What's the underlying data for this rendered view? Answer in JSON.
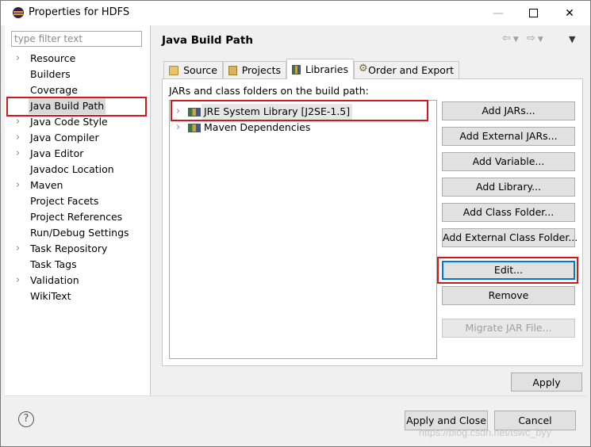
{
  "window": {
    "title": "Properties for HDFS"
  },
  "sidebar": {
    "filter_placeholder": "type filter text",
    "items": [
      {
        "label": "Resource",
        "expandable": true
      },
      {
        "label": "Builders",
        "expandable": false
      },
      {
        "label": "Coverage",
        "expandable": false
      },
      {
        "label": "Java Build Path",
        "expandable": false,
        "selected": true
      },
      {
        "label": "Java Code Style",
        "expandable": true
      },
      {
        "label": "Java Compiler",
        "expandable": true
      },
      {
        "label": "Java Editor",
        "expandable": true
      },
      {
        "label": "Javadoc Location",
        "expandable": false
      },
      {
        "label": "Maven",
        "expandable": true
      },
      {
        "label": "Project Facets",
        "expandable": false
      },
      {
        "label": "Project References",
        "expandable": false
      },
      {
        "label": "Run/Debug Settings",
        "expandable": false
      },
      {
        "label": "Task Repository",
        "expandable": true
      },
      {
        "label": "Task Tags",
        "expandable": false
      },
      {
        "label": "Validation",
        "expandable": true
      },
      {
        "label": "WikiText",
        "expandable": false
      }
    ]
  },
  "main": {
    "title": "Java Build Path",
    "tabs": [
      {
        "label": "Source",
        "icon": "folder-icon"
      },
      {
        "label": "Projects",
        "icon": "project-icon"
      },
      {
        "label": "Libraries",
        "icon": "library-icon",
        "active": true
      },
      {
        "label": "Order and Export",
        "icon": "order-icon"
      }
    ],
    "panel_label": "JARs and class folders on the build path:",
    "libraries": [
      {
        "label": "JRE System Library [J2SE-1.5]",
        "selected": true
      },
      {
        "label": "Maven Dependencies",
        "selected": false
      }
    ],
    "buttons": {
      "add_jars": "Add JARs...",
      "add_external_jars": "Add External JARs...",
      "add_variable": "Add Variable...",
      "add_library": "Add Library...",
      "add_class_folder": "Add Class Folder...",
      "add_external_class_folder": "Add External Class Folder...",
      "edit": "Edit...",
      "remove": "Remove",
      "migrate_jar": "Migrate JAR File..."
    },
    "apply": "Apply"
  },
  "footer": {
    "help": "?",
    "apply_and_close": "Apply and Close",
    "cancel": "Cancel"
  },
  "watermark": "https://blog.csdn.net/tswc_byy",
  "colors": {
    "highlight": "#d0181e",
    "focus": "#0078d7"
  }
}
